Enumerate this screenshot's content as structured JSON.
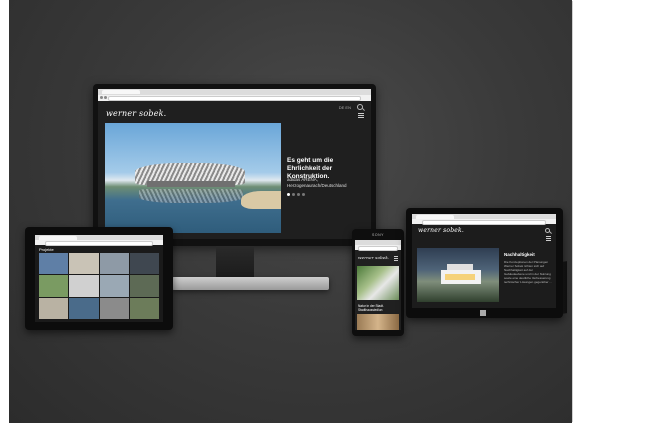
{
  "monitor": {
    "logo": "werner sobek.",
    "lang": "DE EN",
    "hero_headline": "Es geht um die Ehrlichkeit der Konstruktion.",
    "hero_caption": "adidas ARENA, Herzogenaurach/Deutschland"
  },
  "tablet_left": {
    "heading": "Projekte",
    "thumb_colors": [
      "#5f7fa6",
      "#c9c3b6",
      "#8e9aa6",
      "#3f4750",
      "#7a9b62",
      "#d0d0d0",
      "#9aa8b4",
      "#5d6a55",
      "#b9b2a3",
      "#4a6b8a",
      "#8b8b8b",
      "#6c7c5a"
    ]
  },
  "phone": {
    "brand": "SONY",
    "logo": "werner sobek.",
    "headline": "Natur in der Stadt. Stadthaussiedlun"
  },
  "tablet_right": {
    "logo": "werner sobek.",
    "heading": "Nachhaltigkeit",
    "body": "Die Konzeptionen der Planungen Werner Sobek richten sich auf Nachhaltigkeit auf der Gebäudeebene und in der Nutzung sowie eine deutliche Verbesserung technischer Lösungen gegenüber ..."
  }
}
